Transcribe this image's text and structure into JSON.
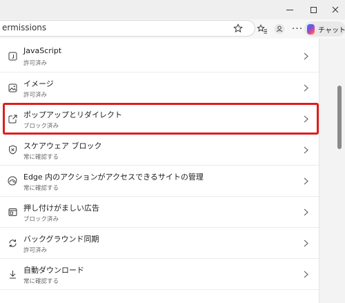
{
  "window": {
    "minimize_label": "minimize",
    "maximize_label": "maximize",
    "close_label": "close"
  },
  "toolbar": {
    "address_text": "ermissions",
    "copilot_label": "チャット",
    "icons": [
      "star-icon",
      "favorites-icon",
      "profile-icon",
      "more-icon",
      "copilot-icon"
    ]
  },
  "permissions": [
    {
      "id": "javascript",
      "icon": "javascript-icon",
      "title": "JavaScript",
      "status": "許可済み"
    },
    {
      "id": "images",
      "icon": "image-icon",
      "title": "イメージ",
      "status": "許可済み"
    },
    {
      "id": "popups",
      "icon": "popup-icon",
      "title": "ポップアップとリダイレクト",
      "status": "ブロック済み"
    },
    {
      "id": "scareware",
      "icon": "shield-icon",
      "title": "スケアウェア ブロック",
      "status": "常に確認する"
    },
    {
      "id": "edge-actions",
      "icon": "edge-icon",
      "title": "Edge 内のアクションがアクセスできるサイトの管理",
      "status": "常に確認する"
    },
    {
      "id": "ads",
      "icon": "ad-icon",
      "title": "押し付けがましい広告",
      "status": "ブロック済み"
    },
    {
      "id": "background-sync",
      "icon": "sync-icon",
      "title": "バックグラウンド同期",
      "status": "許可済み"
    },
    {
      "id": "auto-download",
      "icon": "download-icon",
      "title": "自動ダウンロード",
      "status": "常に確認する"
    }
  ],
  "colors": {
    "highlight": "#e01b1b",
    "background": "#f3f3f3",
    "card": "#ffffff"
  }
}
